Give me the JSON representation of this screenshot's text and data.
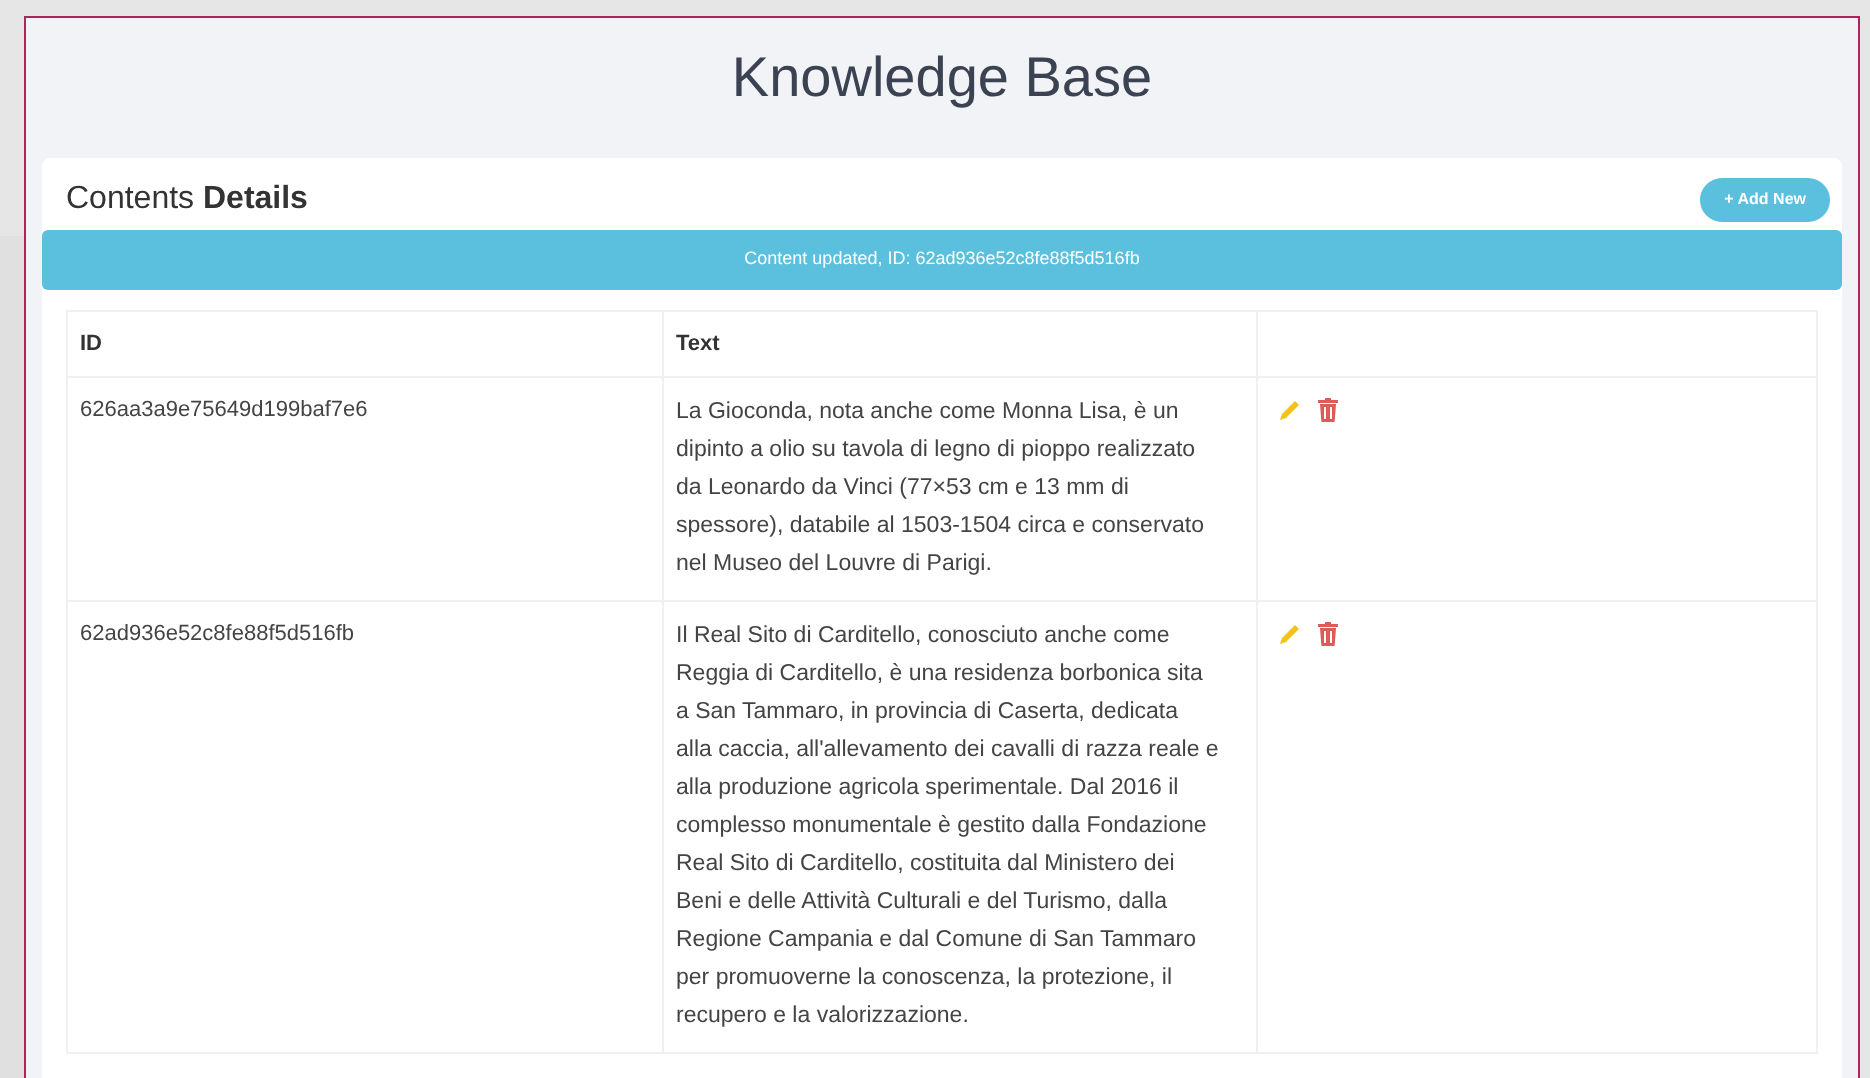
{
  "header": {
    "title": "Knowledge Base"
  },
  "card": {
    "title": "Contents **Details**",
    "add_button": "+ Add New"
  },
  "alert": {
    "text": "Content updated, ID: 62ad936e52c8fe88f5d516fb"
  },
  "table": {
    "columns": [
      "ID",
      "Text",
      ""
    ],
    "rows": [
      {
        "id": "626aa3a9e75649d199baf7e6",
        "text": "La Gioconda, nota anche come Monna Lisa, è un dipinto a olio su tavola di legno di pioppo realizzato da Leonardo da Vinci (77×53 cm e 13 mm di spessore), databile al 1503-1504 circa e conservato nel Museo del Louvre di Parigi."
      },
      {
        "id": "62ad936e52c8fe88f5d516fb",
        "text": "Il Real Sito di Carditello, conosciuto anche come Reggia di Carditello, è una residenza borbonica sita a San Tammaro, in provincia di Caserta, dedicata alla caccia, all'allevamento dei cavalli di razza reale e alla produzione agricola sperimentale. Dal 2016 il complesso monumentale è gestito dalla Fondazione Real Sito di Carditello, costituita dal Ministero dei Beni e delle Attività Culturali e del Turismo, dalla Regione Campania e dal Comune di San Tammaro per promuoverne la conoscenza, la protezione, il recupero e la valorizzazione."
      }
    ]
  }
}
